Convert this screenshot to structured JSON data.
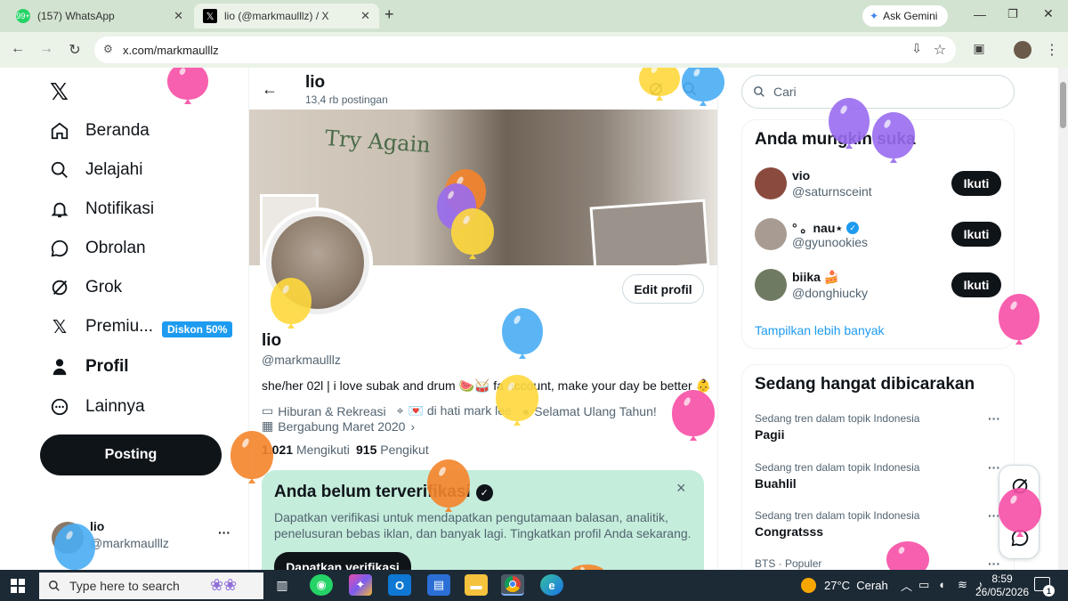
{
  "browser": {
    "tabs": [
      {
        "title": "(157) WhatsApp",
        "favicon_text": "99+"
      },
      {
        "title": "lio (@markmaulllz) / X",
        "favicon_text": "𝕏"
      }
    ],
    "new_tab": "+",
    "gemini_label": "Ask Gemini",
    "url": "x.com/markmaulllz"
  },
  "nav": {
    "logo": "𝕏",
    "items": [
      {
        "label": "Beranda"
      },
      {
        "label": "Jelajahi"
      },
      {
        "label": "Notifikasi"
      },
      {
        "label": "Obrolan"
      },
      {
        "label": "Grok"
      },
      {
        "label": "Premiu...",
        "badge": "Diskon 50%"
      },
      {
        "label": "Profil"
      },
      {
        "label": "Lainnya"
      }
    ],
    "post_button": "Posting",
    "account": {
      "name": "lio",
      "handle": "@markmaulllz",
      "more": "···"
    }
  },
  "profile": {
    "header_name": "lio",
    "post_count": "13,4 rb postingan",
    "banner_text": "Try Again",
    "edit_button": "Edit profil",
    "name": "lio",
    "handle": "@markmaulllz",
    "bio": "she/her 02l | i love subak and drum 🍉🥁 fa account, make your day be better 👶",
    "category": "Hiburan & Rekreasi",
    "location": "💌 di hati mark lee",
    "birthday": "Selamat Ulang Tahun!",
    "joined": "Bergabung Maret 2020",
    "following_count": "1.021",
    "following_label": "Mengikuti",
    "followers_count": "915",
    "followers_label": "Pengikut"
  },
  "verify_card": {
    "title": "Anda belum terverifikasi",
    "body": "Dapatkan verifikasi untuk mendapatkan pengutamaan balasan, analitik, penelusuran bebas iklan, dan banyak lagi. Tingkatkan profil Anda sekarang.",
    "button": "Dapatkan verifikasi",
    "close": "×"
  },
  "sidebar": {
    "search_placeholder": "Cari",
    "suggest_title": "Anda mungkin suka",
    "suggestions": [
      {
        "name": "vio",
        "handle": "@saturnsceint",
        "follow": "Ikuti"
      },
      {
        "name": "° 。nau⋆",
        "handle": "@gyunookies",
        "follow": "Ikuti"
      },
      {
        "name": "biika 🍰",
        "handle": "@donghiucky",
        "follow": "Ikuti"
      }
    ],
    "show_more": "Tampilkan lebih banyak",
    "trends_title": "Sedang hangat dibicarakan",
    "trends": [
      {
        "meta": "Sedang tren dalam topik Indonesia",
        "name": "Pagii"
      },
      {
        "meta": "Sedang tren dalam topik Indonesia",
        "name": "Buahlil"
      },
      {
        "meta": "Sedang tren dalam topik Indonesia",
        "name": "Congratsss"
      },
      {
        "meta": "BTS · Populer",
        "name": ""
      }
    ],
    "more_dots": "···"
  },
  "taskbar": {
    "search_placeholder": "Type here to search",
    "weather": "27°C  Cerah",
    "time": "8:59",
    "date": "26/05/2026",
    "notif_count": "1"
  },
  "colors": {
    "accent": "#1d9bf0",
    "verify_bg": "#c4eddb",
    "tabbar": "#d3e3d1",
    "toolbar": "#ebf3e9",
    "taskbar": "#1c2a36"
  }
}
